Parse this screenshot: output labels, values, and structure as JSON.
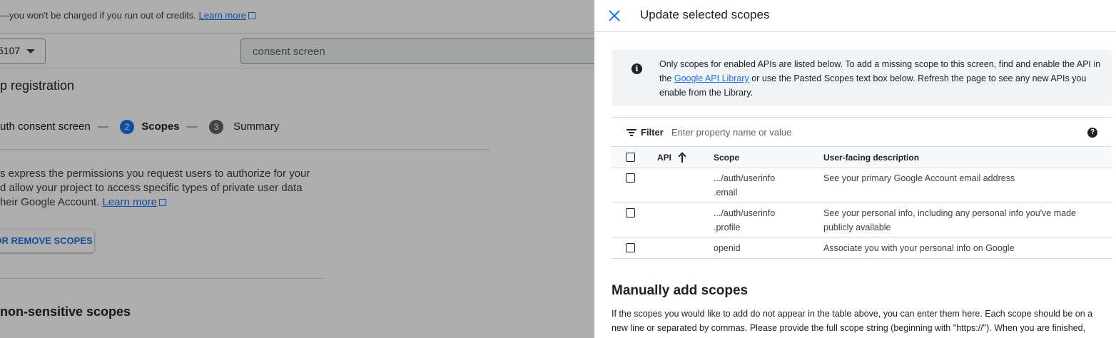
{
  "background": {
    "banner_text": "—you won't be charged if you run out of credits.",
    "banner_link": "Learn more",
    "project_value": "5107",
    "search_value": "consent screen",
    "section_title": "p registration",
    "steps": [
      {
        "number": "",
        "label": "uth consent screen"
      },
      {
        "number": "2",
        "label": "Scopes"
      },
      {
        "number": "3",
        "label": "Summary"
      }
    ],
    "step_separator": "—",
    "description_lines": [
      "s express the permissions you request users to authorize for your",
      "d allow your project to access specific types of private user data",
      "heir Google Account."
    ],
    "description_link": "Learn more",
    "scopes_button": "OR REMOVE SCOPES",
    "nonsensitive_title": "non-sensitive scopes"
  },
  "panel": {
    "title": "Update selected scopes",
    "info": {
      "text_before": "Only scopes for enabled APIs are listed below. To add a missing scope to this screen, find and enable the API in the",
      "link": "Google API Library",
      "text_after": "or use the Pasted Scopes text box below. Refresh the page to see any new APIs you enable from the Library."
    },
    "filter": {
      "label": "Filter",
      "placeholder": "Enter property name or value",
      "help_icon": "?"
    },
    "table": {
      "headers": {
        "api": "API",
        "scope": "Scope",
        "description": "User-facing description"
      },
      "sort": "ascending",
      "rows": [
        {
          "scope_lines": [
            ".../auth/userinfo",
            ".email"
          ],
          "description": "See your primary Google Account email address"
        },
        {
          "scope_lines": [
            ".../auth/userinfo",
            ".profile"
          ],
          "description": "See your personal info, including any personal info you've made publicly available"
        },
        {
          "scope_lines": [
            "openid"
          ],
          "description": "Associate you with your personal info on Google"
        }
      ]
    },
    "manual": {
      "title": "Manually add scopes",
      "text": "If the scopes you would like to add do not appear in the table above, you can enter them here. Each scope should be on a new line or separated by commas. Please provide the full scope string (beginning with \"https://\"). When you are finished,"
    }
  },
  "colors": {
    "accent": "#1a73e8",
    "overlay": "rgba(0,0,0,0.32)"
  }
}
